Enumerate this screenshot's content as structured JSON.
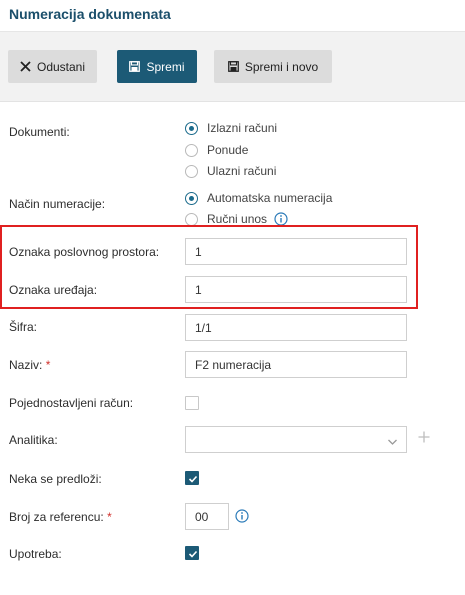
{
  "header": {
    "title": "Numeracija dokumenata"
  },
  "toolbar": {
    "cancel_label": "Odustani",
    "save_label": "Spremi",
    "save_new_label": "Spremi i novo"
  },
  "form": {
    "documents": {
      "label": "Dokumenti:",
      "options": [
        {
          "label": "Izlazni računi",
          "selected": true
        },
        {
          "label": "Ponude",
          "selected": false
        },
        {
          "label": "Ulazni računi",
          "selected": false
        }
      ]
    },
    "numbering_method": {
      "label": "Način numeracije:",
      "options": [
        {
          "label": "Automatska numeracija",
          "selected": true
        },
        {
          "label": "Ručni unos",
          "selected": false
        }
      ]
    },
    "business_premises": {
      "label": "Oznaka poslovnog prostora:",
      "value": "1"
    },
    "device": {
      "label": "Oznaka uređaja:",
      "value": "1"
    },
    "code": {
      "label": "Šifra:",
      "value": "1/1"
    },
    "name": {
      "label": "Naziv:",
      "required_mark": "*",
      "value": "F2 numeracija"
    },
    "simplified_invoice": {
      "label": "Pojednostavljeni račun:",
      "checked": false
    },
    "analytics": {
      "label": "Analitika:",
      "value": ""
    },
    "dont_propose": {
      "label": "Neka se predloži:",
      "checked": true
    },
    "reference_number": {
      "label": "Broj za referencu:",
      "required_mark": "*",
      "value": "00"
    },
    "usage": {
      "label": "Upotreba:",
      "checked": true
    }
  },
  "colors": {
    "accent": "#1c5a76",
    "title": "#1b4f6b",
    "highlight": "#e02020",
    "info": "#2a7ab8"
  }
}
